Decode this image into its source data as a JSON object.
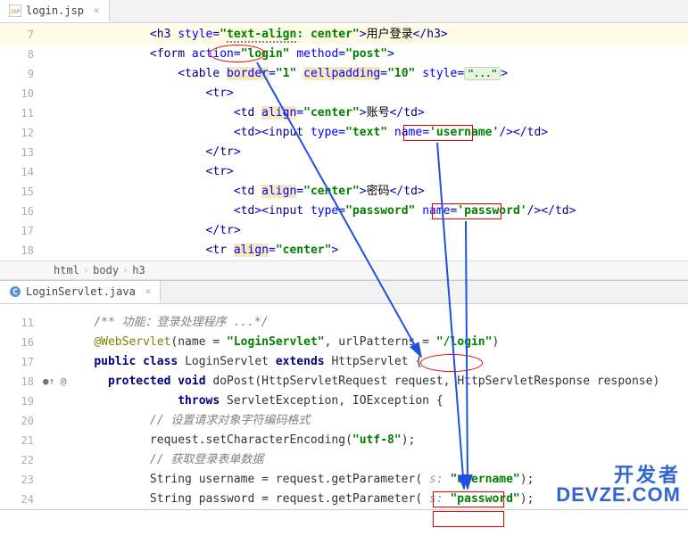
{
  "topTab": {
    "name": "login.jsp",
    "icon": "jsp"
  },
  "topLines": {
    "l7": {
      "n": "7",
      "pre": "            ",
      "content": "<h3 style=\"text-align: center\">用户登录</h3>"
    },
    "l8": {
      "n": "8",
      "pre": "            ",
      "content": "<form action=\"login\" method=\"post\">"
    },
    "l9": {
      "n": "9",
      "pre": "                ",
      "content": "<table border=\"1\" cellpadding=\"10\" style=\"...\">"
    },
    "l10": {
      "n": "10",
      "pre": "                    ",
      "content": "<tr>"
    },
    "l11": {
      "n": "11",
      "pre": "                        ",
      "content": "<td align=\"center\">账号</td>"
    },
    "l12": {
      "n": "12",
      "pre": "                        ",
      "content": "<td><input type=\"text\" name='username'/></td>"
    },
    "l13": {
      "n": "13",
      "pre": "                    ",
      "content": "</tr>"
    },
    "l14": {
      "n": "14",
      "pre": "                    ",
      "content": "<tr>"
    },
    "l15": {
      "n": "15",
      "pre": "                        ",
      "content": "<td align=\"center\">密码</td>"
    },
    "l16": {
      "n": "16",
      "pre": "                        ",
      "content": "<td><input type=\"password\" name='password'/></td>"
    },
    "l17": {
      "n": "17",
      "pre": "                    ",
      "content": "</tr>"
    },
    "l18": {
      "n": "18",
      "pre": "                    ",
      "content": "<tr align=\"center\">"
    }
  },
  "breadcrumb": {
    "a": "html",
    "b": "body",
    "c": "h3"
  },
  "bottomTab": {
    "name": "LoginServlet.java",
    "icon": "java"
  },
  "bottomLines": {
    "l11": {
      "n": "11",
      "comment": "/** 功能：登录处理程序 ...*/"
    },
    "l16": {
      "n": "16",
      "anno": "@WebServlet",
      "name": "name = ",
      "nameVal": "\"LoginServlet\"",
      "url": ", urlPatterns = ",
      "urlVal": "\"/login\""
    },
    "l17": {
      "n": "17",
      "kw1": "public class ",
      "cls": "LoginServlet ",
      "kw2": "extends ",
      "sup": "HttpServlet {"
    },
    "l18": {
      "n": "18",
      "ge": "@",
      "kw": "protected void ",
      "m": "doPost",
      "p": "(HttpServletRequest request, HttpServletResponse response)"
    },
    "l19": {
      "n": "19",
      "kw": "throws ",
      "ex": "ServletException, IOException {"
    },
    "l20": {
      "n": "20",
      "cm": "// 设置请求对象字符编码格式"
    },
    "l21": {
      "n": "21",
      "code": "request.setCharacterEncoding(",
      "str": "\"utf-8\"",
      "end": ");"
    },
    "l22": {
      "n": "22",
      "cm": "// 获取登录表单数据"
    },
    "l23": {
      "n": "23",
      "code": "String username = request.getParameter( ",
      "hint": "s: ",
      "str": "\"username\"",
      "end": ");"
    },
    "l24": {
      "n": "24",
      "code": "String password = request.getParameter( ",
      "hint": "s: ",
      "str": "\"password\"",
      "end": ");"
    }
  },
  "watermark": {
    "cn": "开发者",
    "en": "DEVZE.COM"
  }
}
